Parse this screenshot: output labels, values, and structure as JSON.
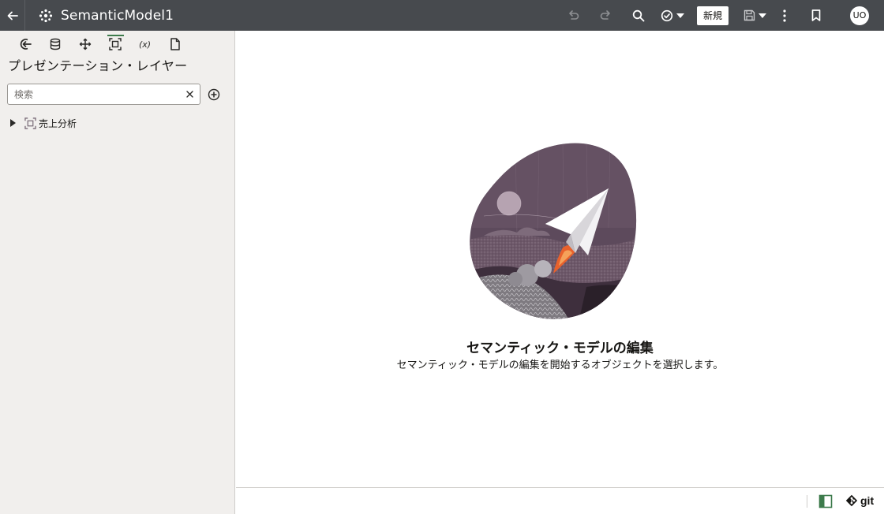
{
  "header": {
    "title": "SemanticModel1",
    "new_label": "新規",
    "avatar_initials": "UO",
    "icons": [
      "back-arrow-icon",
      "semantic-model-icon",
      "undo-icon",
      "redo-icon",
      "search-icon",
      "check-circle-icon",
      "chevron-down-icon",
      "save-icon",
      "more-vertical-icon",
      "bookmark-icon"
    ]
  },
  "sidebar": {
    "toolbar_icons": [
      "physical-layer-icon",
      "database-icon",
      "logical-layer-icon",
      "presentation-layer-icon",
      "variables-icon",
      "document-icon"
    ],
    "active_tool": "presentation-layer-icon",
    "heading": "プレゼンテーション・レイヤー",
    "search": {
      "placeholder": "検索",
      "value": ""
    },
    "tree": [
      {
        "label": "売上分析",
        "expanded": false
      }
    ]
  },
  "main": {
    "empty_title": "セマンティック・モデルの編集",
    "empty_subtitle": "セマンティック・モデルの編集を開始するオブジェクトを選択します。"
  },
  "footer": {
    "git_label": "git"
  },
  "colors": {
    "header_bg": "#474a4e",
    "sidebar_bg": "#f1efed",
    "accent_green": "#3d7b4c",
    "illustration_purple": "#5a4658",
    "flame_orange": "#e8612c"
  }
}
